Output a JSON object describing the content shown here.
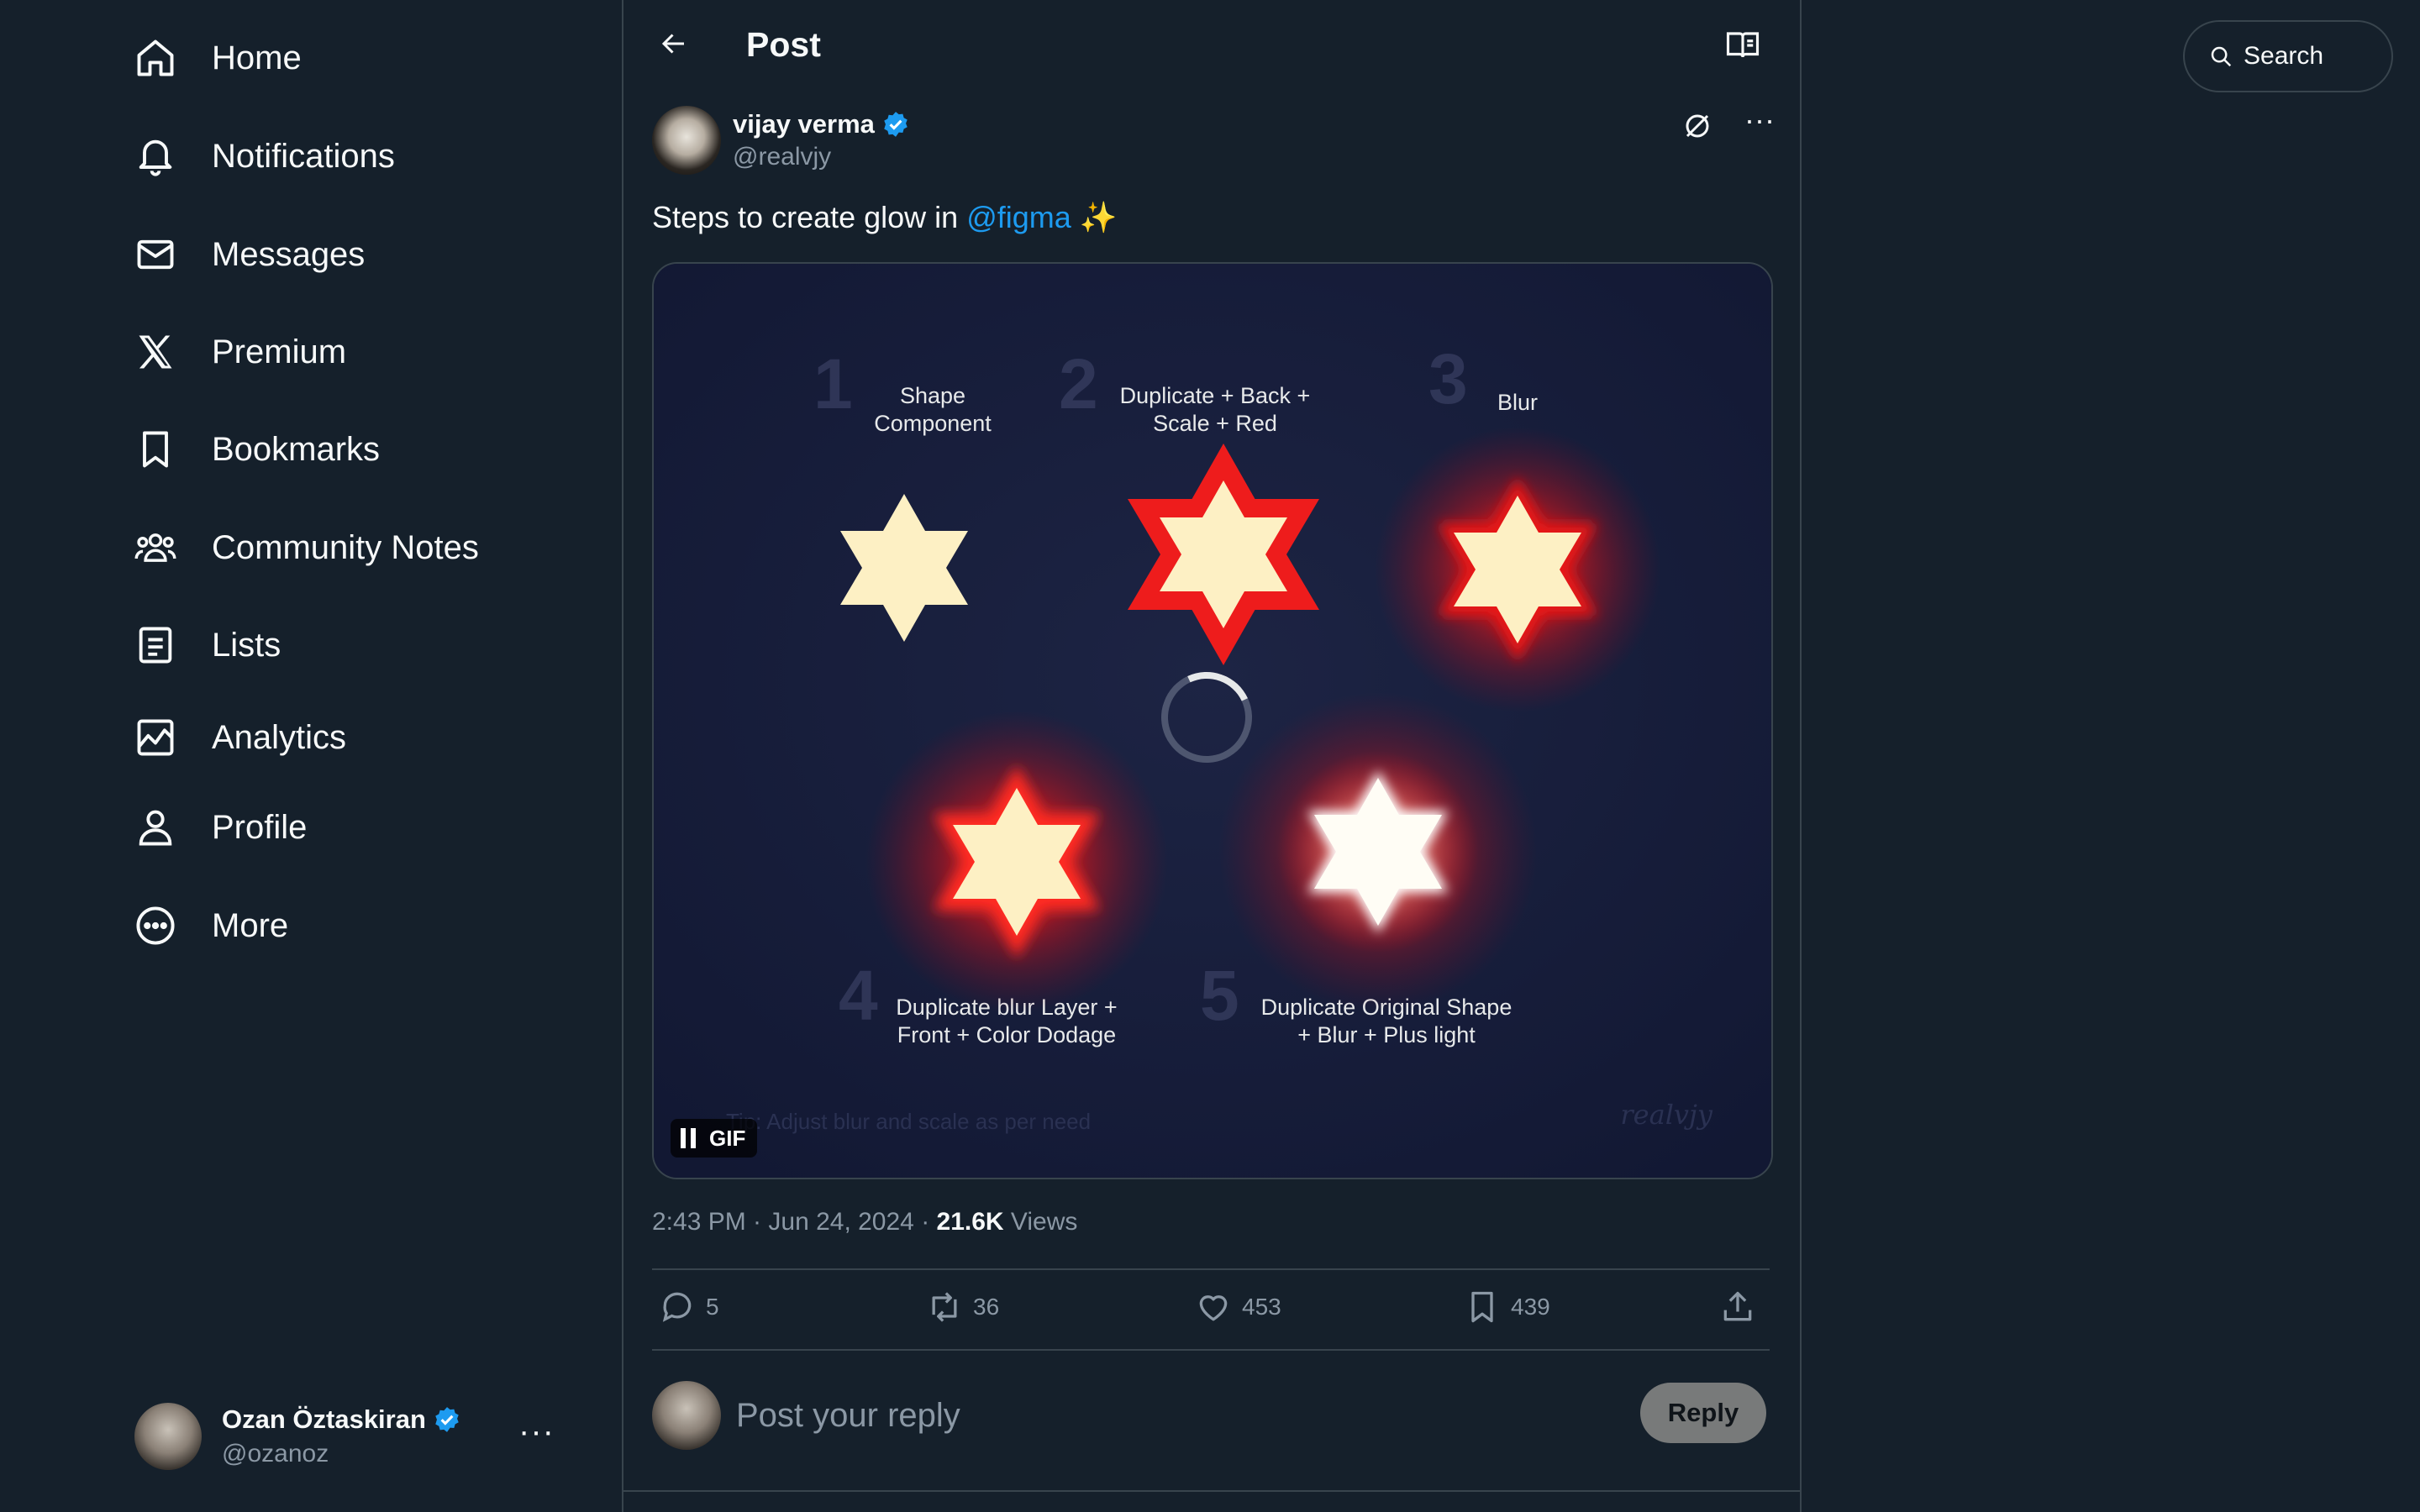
{
  "nav": {
    "items": [
      {
        "label": "Home",
        "icon": "home-icon"
      },
      {
        "label": "Notifications",
        "icon": "bell-icon"
      },
      {
        "label": "Messages",
        "icon": "envelope-icon"
      },
      {
        "label": "Premium",
        "icon": "x-logo-icon"
      },
      {
        "label": "Bookmarks",
        "icon": "bookmark-icon"
      },
      {
        "label": "Community Notes",
        "icon": "people-icon"
      },
      {
        "label": "Lists",
        "icon": "list-icon"
      },
      {
        "label": "Analytics",
        "icon": "chart-icon"
      },
      {
        "label": "Profile",
        "icon": "person-icon"
      },
      {
        "label": "More",
        "icon": "more-circle-icon"
      }
    ]
  },
  "account": {
    "name": "Ozan Öztaskiran",
    "handle": "@ozanoz",
    "more": "···"
  },
  "header": {
    "title": "Post"
  },
  "post": {
    "author_name": "vijay verma",
    "author_handle": "@realvjy",
    "text_prefix": "Steps to create glow in ",
    "mention": "@figma",
    "emoji": "✨",
    "media": {
      "badge": "GIF",
      "steps": [
        {
          "num": "1",
          "line1": "Shape",
          "line2": "Component"
        },
        {
          "num": "2",
          "line1": "Duplicate + Back +",
          "line2": "Scale + Red"
        },
        {
          "num": "3",
          "line1": "Blur",
          "line2": ""
        },
        {
          "num": "4",
          "line1": "Duplicate blur Layer +",
          "line2": "Front + Color Dodage"
        },
        {
          "num": "5",
          "line1": "Duplicate Original Shape",
          "line2": "+ Blur + Plus light"
        }
      ],
      "tip": "Tip: Adjust blur and scale as per need",
      "signature": "realvjy"
    },
    "time": "2:43 PM · Jun 24, 2024 · ",
    "views_count": "21.6K",
    "views_label": " Views",
    "stats": {
      "replies": "5",
      "reposts": "36",
      "likes": "453",
      "bookmarks": "439"
    }
  },
  "reply": {
    "placeholder": "Post your reply",
    "button": "Reply"
  },
  "search": {
    "label": "Search"
  },
  "colors": {
    "accent": "#1d9bf0",
    "background": "#15202b",
    "border": "#38444d",
    "glow_red": "#e8141c",
    "star_fill": "#fdf0c4"
  }
}
